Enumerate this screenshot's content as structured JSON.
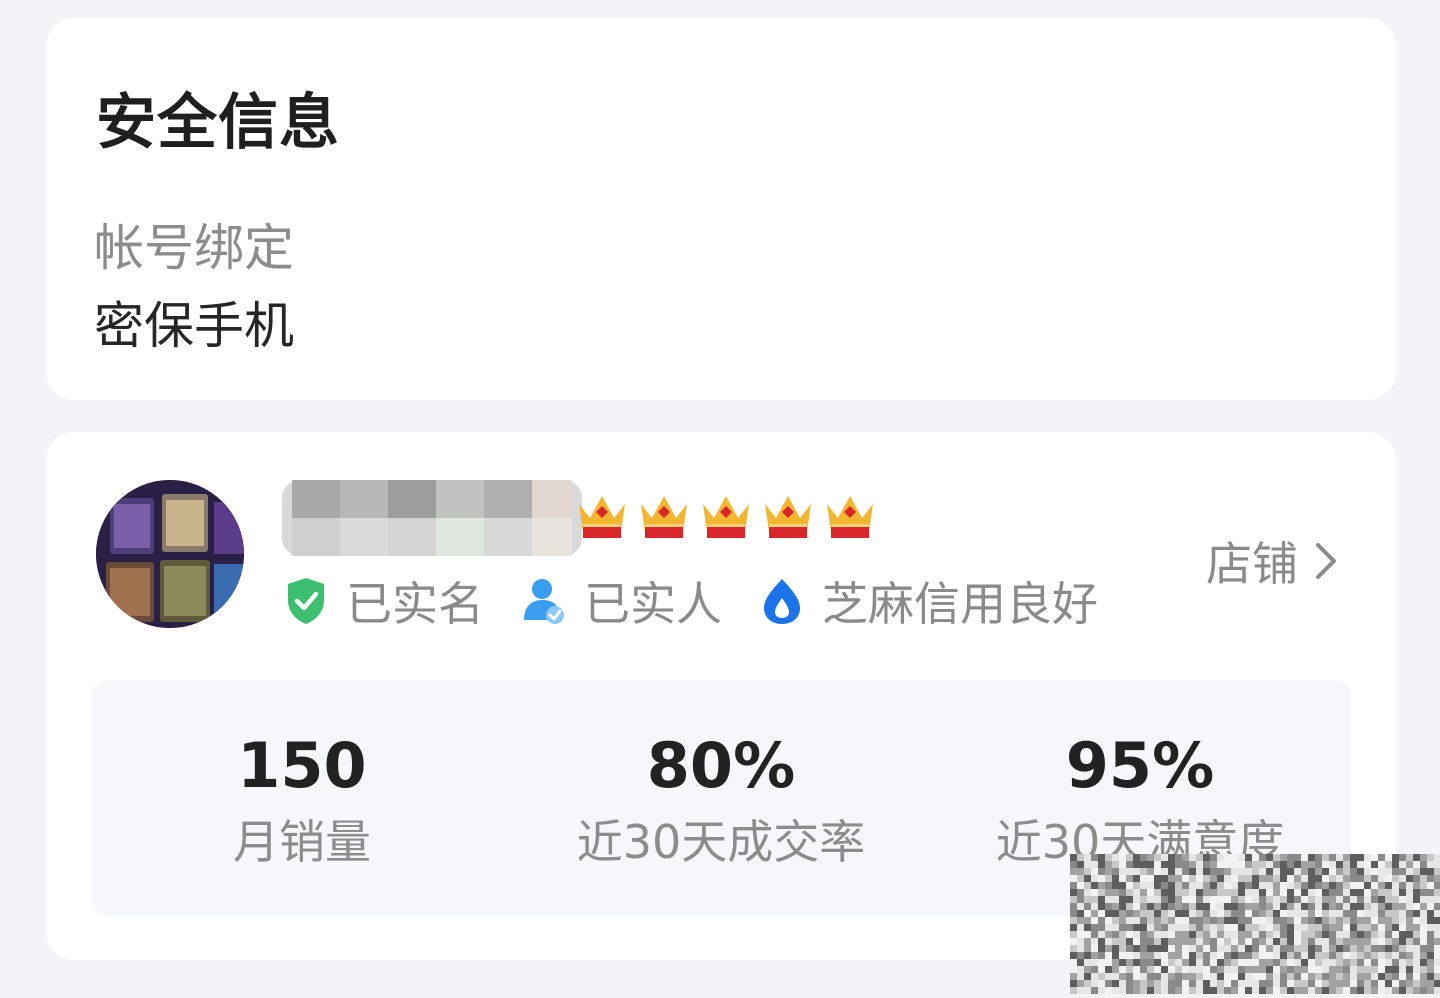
{
  "security": {
    "title": "安全信息",
    "binding_label": "帐号绑定",
    "binding_value": "密保手机"
  },
  "seller": {
    "crown_count": 5,
    "badges": [
      {
        "icon": "green-shield-check-icon",
        "label": "已实名"
      },
      {
        "icon": "person-verified-icon",
        "label": "已实人"
      },
      {
        "icon": "sesame-credit-icon",
        "label": "芝麻信用良好"
      }
    ],
    "shop_label": "店铺",
    "stats": [
      {
        "value": "150",
        "label": "月销量"
      },
      {
        "value": "80%",
        "label": "近30天成交率"
      },
      {
        "value": "95%",
        "label": "近30天满意度"
      }
    ]
  },
  "colors": {
    "page_bg": "#f3f4f8",
    "card_bg": "#ffffff",
    "stats_bg": "#f6f7fa",
    "shield_green": "#3cbf6e",
    "person_blue": "#3b9df0",
    "sesame_blue": "#1a73e8",
    "crown_gold": "#f2b630",
    "crown_red": "#d8262b"
  }
}
